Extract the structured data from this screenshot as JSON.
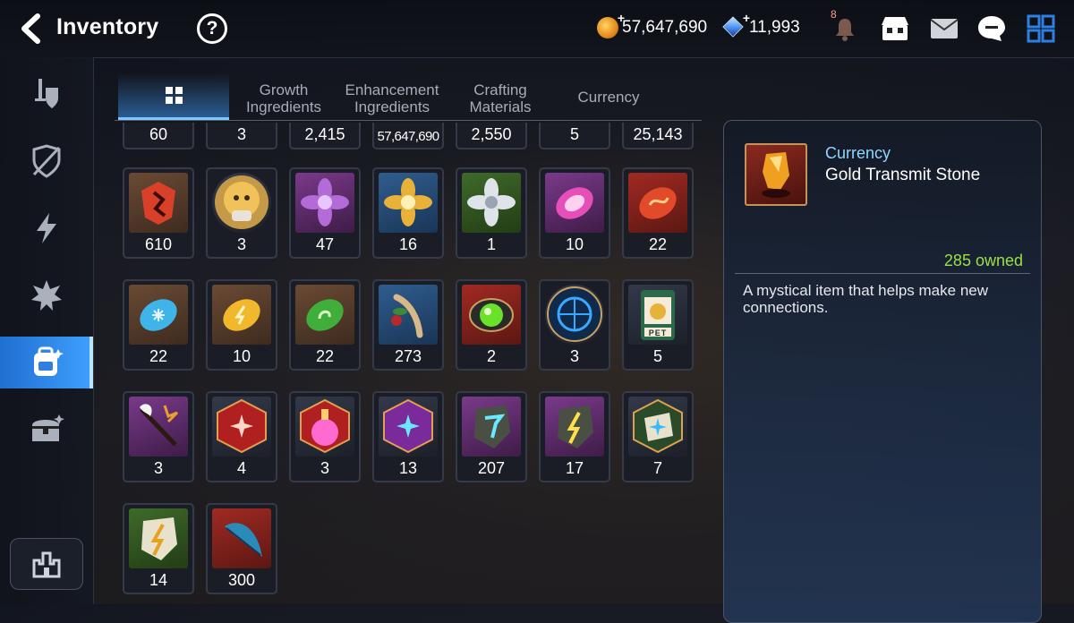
{
  "header": {
    "title": "Inventory",
    "help_label": "?",
    "gold_amount": "57,647,690",
    "gem_amount": "11,993",
    "notification_count": "8"
  },
  "tabs": [
    {
      "label": ""
    },
    {
      "label": "Growth\nIngredients"
    },
    {
      "label": "Enhancement\nIngredients"
    },
    {
      "label": "Crafting\nMaterials"
    },
    {
      "label": "Currency"
    }
  ],
  "sidebar": {
    "items": [
      "equipment-icon",
      "artifact-icon",
      "skill-icon",
      "catalyst-icon",
      "material-bag-icon",
      "chest-icon"
    ],
    "active_index": 4
  },
  "items": {
    "row0": [
      "60",
      "3",
      "2,415",
      "57,647,690",
      "2,550",
      "5",
      "25,143"
    ],
    "row1": [
      "610",
      "3",
      "47",
      "16",
      "1",
      "10",
      "22"
    ],
    "row2": [
      "22",
      "10",
      "22",
      "273",
      "2",
      "3",
      "5"
    ],
    "row3": [
      "3",
      "4",
      "3",
      "13",
      "207",
      "17",
      "7"
    ],
    "row4": [
      "14",
      "300"
    ]
  },
  "pet_label": "PET",
  "detail": {
    "category": "Currency",
    "name": "Gold Transmit Stone",
    "owned": "285 owned",
    "description": "A mystical item that helps make new connections."
  },
  "colors": {
    "accent": "#3fa0ff",
    "owned_green": "#9be048",
    "category_blue": "#8fd6ff"
  }
}
